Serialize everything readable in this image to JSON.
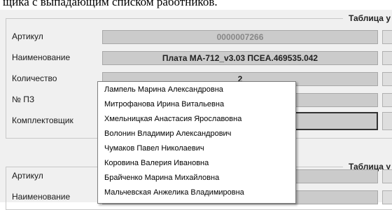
{
  "doc_text": "щика с выпадающим списком работников.",
  "group1": {
    "title": "Таблица у",
    "rows": [
      {
        "label": "Артикул",
        "value": "0000007266"
      },
      {
        "label": "Наименование",
        "value": "Плата МА-712_v3.03  ПСЕА.469535.042"
      },
      {
        "label": "Количество",
        "value": "2"
      },
      {
        "label": "№ ПЗ",
        "value": ""
      },
      {
        "label": "Комплектовщик",
        "value": ""
      }
    ]
  },
  "group2": {
    "title": "Таблица у",
    "rows": [
      {
        "label": "Артикул",
        "value": ""
      },
      {
        "label": "Наименование",
        "value": ""
      }
    ]
  },
  "workers": [
    "Лампель Марина Александровна",
    "Митрофанова Ирина Витальевна",
    "Хмельницкая Анастасия Ярославовна",
    "Волонин Владимир Александрович",
    "Чумаков Павел Николаевич",
    "Коровина Валерия Ивановна",
    "Брайченко Марина Михайловна",
    "Мальчевская Анжелика Владимировна"
  ]
}
